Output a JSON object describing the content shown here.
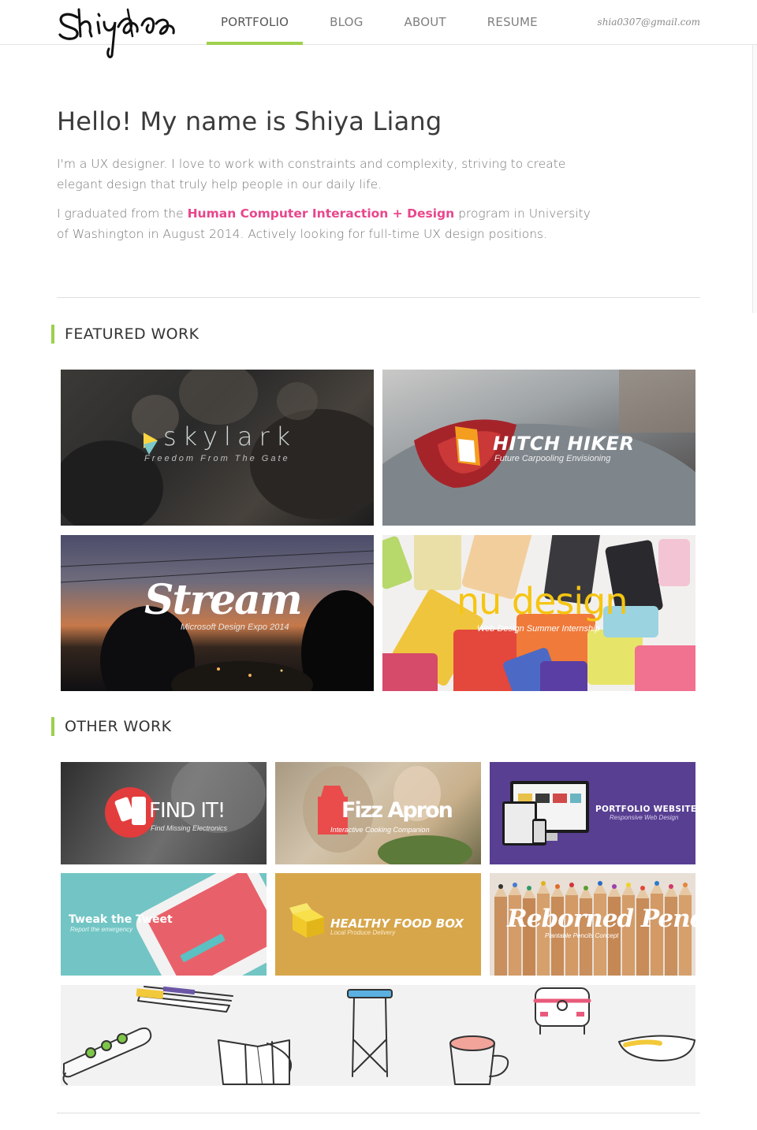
{
  "header": {
    "logo_text": "Shiya",
    "nav": [
      {
        "label": "PORTFOLIO",
        "active": true
      },
      {
        "label": "BLOG",
        "active": false
      },
      {
        "label": "ABOUT",
        "active": false
      },
      {
        "label": "RESUME",
        "active": false
      }
    ],
    "email": "shia0307@gmail.com"
  },
  "hero": {
    "title": "Hello! My name is Shiya Liang",
    "p1": "I'm a UX designer. I love to work with constraints and complexity, striving to create elegant design that truly help people in our daily life.",
    "p2_before": "I graduated from the ",
    "p2_highlight": "Human Computer Interaction + Design",
    "p2_after": " program in University of Washington in August 2014. Actively looking for full-time UX design positions."
  },
  "featured": {
    "title": "FEATURED WORK",
    "items": [
      {
        "name": "skylark",
        "subtitle": "Freedom From The Gate"
      },
      {
        "name": "HITCH HIKER",
        "subtitle": "Future Carpooling Envisioning"
      },
      {
        "name": "Stream",
        "subtitle": "Microsoft Design Expo 2014"
      },
      {
        "name": "nu design",
        "subtitle": "Web Design Summer Internship"
      }
    ]
  },
  "other": {
    "title": "OTHER WORK",
    "items": [
      {
        "name": "FIND IT!",
        "subtitle": "Find Missing Electronics"
      },
      {
        "name": "Fizz Apron",
        "subtitle": "Interactive Cooking Companion"
      },
      {
        "name": "PORTFOLIO WEBSITE",
        "subtitle": "Responsive Web Design"
      },
      {
        "name": "Tweak the Tweet",
        "subtitle": "Report the emergency"
      },
      {
        "name": "HEALTHY FOOD BOX",
        "subtitle": "Local Produce Delivery"
      },
      {
        "name": "Reborned Pencil",
        "subtitle": "Plantable Pencils Concept"
      }
    ]
  },
  "colors": {
    "accent": "#9ed04c",
    "highlight": "#e8468c"
  }
}
